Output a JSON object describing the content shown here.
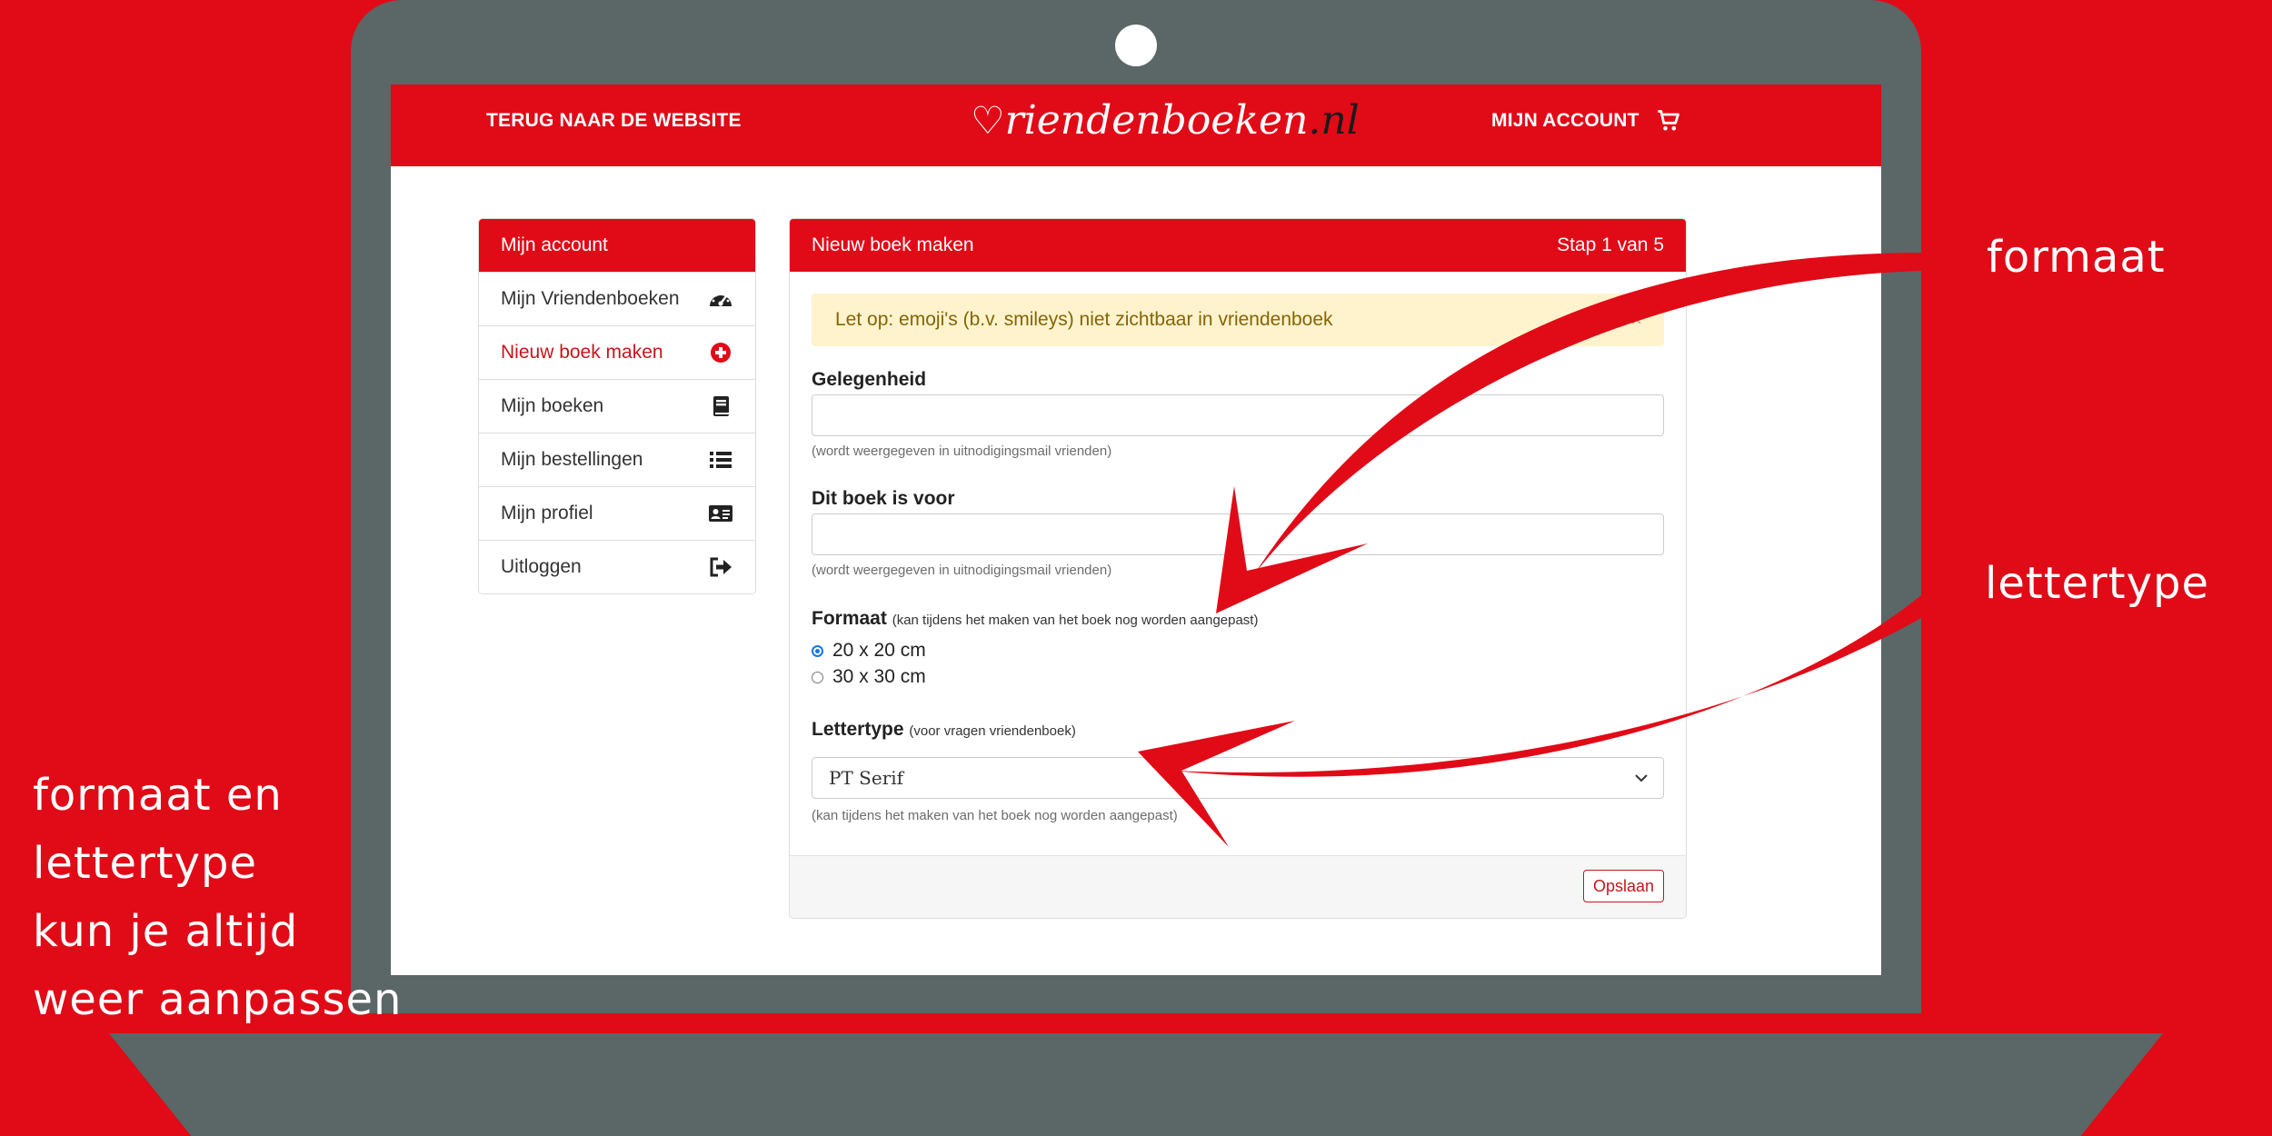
{
  "header": {
    "back_link": "TERUG NAAR DE WEBSITE",
    "logo_text": "riendenboeken",
    "logo_tld": ".nl",
    "account_link": "MIJN ACCOUNT",
    "cart_icon": "shopping-cart-icon"
  },
  "sidebar": {
    "title": "Mijn account",
    "items": [
      {
        "label": "Mijn Vriendenboeken",
        "icon": "dashboard-icon",
        "active": false
      },
      {
        "label": "Nieuw boek maken",
        "icon": "plus-circle-icon",
        "active": true
      },
      {
        "label": "Mijn boeken",
        "icon": "book-icon",
        "active": false
      },
      {
        "label": "Mijn bestellingen",
        "icon": "list-icon",
        "active": false
      },
      {
        "label": "Mijn profiel",
        "icon": "id-card-icon",
        "active": false
      },
      {
        "label": "Uitloggen",
        "icon": "sign-out-icon",
        "active": false
      }
    ]
  },
  "form": {
    "title": "Nieuw boek maken",
    "step": "Stap 1 van 5",
    "alert": "Let op: emoji's (b.v. smileys) niet zichtbaar in vriendenboek",
    "alert_close": "×",
    "occasion_label": "Gelegenheid",
    "occasion_value": "",
    "occasion_help": "(wordt weergegeven in uitnodigingsmail vrienden)",
    "for_label": "Dit boek is voor",
    "for_value": "",
    "for_help": "(wordt weergegeven in uitnodigingsmail vrienden)",
    "format_label": "Formaat",
    "format_hint": "(kan tijdens het maken van het boek nog worden aangepast)",
    "format_options": [
      "20 x 20 cm",
      "30 x 30 cm"
    ],
    "format_selected": "20 x 20 cm",
    "font_label": "Lettertype",
    "font_hint": "(voor vragen vriendenboek)",
    "font_value": "PT Serif",
    "font_help": "(kan tijdens het maken van het boek nog worden aangepast)",
    "save_label": "Opslaan"
  },
  "annotations": {
    "formaat": "formaat",
    "lettertype": "lettertype",
    "bottom_lines": [
      "formaat en",
      "lettertype",
      "kun je altijd",
      "weer aanpassen"
    ]
  },
  "colors": {
    "brand_red": "#e10a17",
    "laptop_gray": "#5b6666",
    "alert_bg": "#fff3cd"
  }
}
